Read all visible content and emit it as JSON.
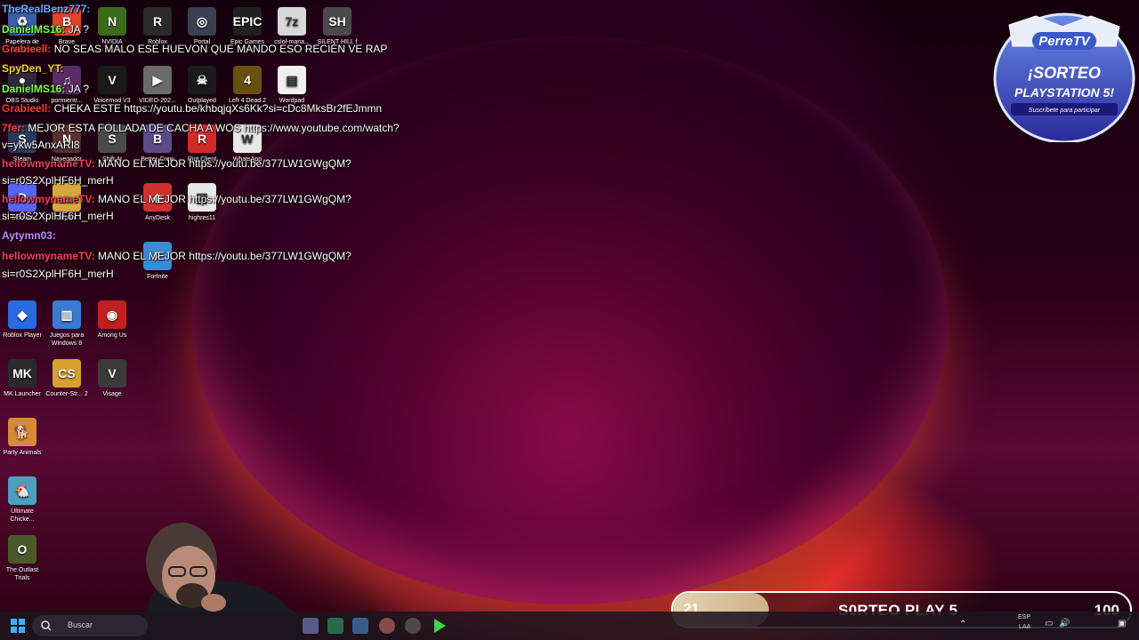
{
  "desktop_icons": [
    {
      "id": "recycle",
      "label": "Papelera de reciclaje",
      "glyph": "♻",
      "color": "#3a5ea8"
    },
    {
      "id": "brave",
      "label": "Brave",
      "glyph": "B",
      "color": "#e0442a"
    },
    {
      "id": "nvidia",
      "label": "NVIDIA",
      "glyph": "N",
      "color": "#3a6b1a"
    },
    {
      "id": "roblox",
      "label": "Roblox",
      "glyph": "R",
      "color": "#2a2a2a"
    },
    {
      "id": "portal",
      "label": "Portal",
      "glyph": "◎",
      "color": "#3a4050"
    },
    {
      "id": "epic",
      "label": "Epic Games",
      "glyph": "EPIC",
      "color": "#202020"
    },
    {
      "id": "7z",
      "label": "cslol-mana...",
      "glyph": "7z",
      "color": "#d8d8d8"
    },
    {
      "id": "silent",
      "label": "SILENT HILL f",
      "glyph": "SH",
      "color": "#4a4a4a"
    },
    {
      "id": "obs",
      "label": "OBS Studio",
      "glyph": "●",
      "color": "#302838"
    },
    {
      "id": "pormientr",
      "label": "pormientr...",
      "glyph": "♫",
      "color": "#5a2a6a"
    },
    {
      "id": "voicemod",
      "label": "Voicemod V3",
      "glyph": "V",
      "color": "#1a1a1a"
    },
    {
      "id": "video",
      "label": "VIDEO-202...",
      "glyph": "▶",
      "color": "#6a6a6a"
    },
    {
      "id": "outplayed",
      "label": "Outplayed",
      "glyph": "☠",
      "color": "#1a1a1a"
    },
    {
      "id": "l4d2",
      "label": "Left 4 Dead 2",
      "glyph": "4",
      "color": "#6a5010"
    },
    {
      "id": "wordpad",
      "label": "Wordpad",
      "glyph": "▤",
      "color": "#f0f0f0"
    },
    {
      "id": "steam",
      "label": "Steam",
      "glyph": "S",
      "color": "#2a3a5a"
    },
    {
      "id": "navegador",
      "label": "Navegador",
      "glyph": "N",
      "color": "#5a3030"
    },
    {
      "id": "shiftat",
      "label": "Shift At",
      "glyph": "S",
      "color": "#4a4a4a"
    },
    {
      "id": "bettercrew",
      "label": "Better-Crew",
      "glyph": "B",
      "color": "#5a4a8a"
    },
    {
      "id": "riot",
      "label": "Riot Client",
      "glyph": "R",
      "color": "#d02a2a"
    },
    {
      "id": "whatsapp",
      "label": "WhatsApp",
      "glyph": "W",
      "color": "#e8e8e8"
    },
    {
      "id": "discord",
      "label": "Discord",
      "glyph": "D",
      "color": "#5865f2"
    },
    {
      "id": "carpeta",
      "label": "carpeta",
      "glyph": "▬",
      "color": "#d8a840"
    },
    {
      "id": "anydesk",
      "label": "AnyDesk",
      "glyph": "◆",
      "color": "#d03030"
    },
    {
      "id": "highres",
      "label": "highres11",
      "glyph": "▤",
      "color": "#e8e8e8"
    },
    {
      "id": "fortnite",
      "label": "Fortnite",
      "glyph": "F",
      "color": "#3a8ad8"
    },
    {
      "id": "robloxplayer",
      "label": "Roblox Player",
      "glyph": "◆",
      "color": "#2a6ae0"
    },
    {
      "id": "juegos",
      "label": "Juegos para Windows 8",
      "glyph": "▥",
      "color": "#3a7ad0"
    },
    {
      "id": "amongus",
      "label": "Among Us",
      "glyph": "◉",
      "color": "#c02020"
    },
    {
      "id": "mk",
      "label": "MK Launcher",
      "glyph": "MK",
      "color": "#2a2a2a"
    },
    {
      "id": "cs2",
      "label": "Counter-Str... 2",
      "glyph": "CS",
      "color": "#d8a030"
    },
    {
      "id": "visage",
      "label": "Visage",
      "glyph": "V",
      "color": "#3a3a3a"
    },
    {
      "id": "party",
      "label": "Party Animals",
      "glyph": "🐕",
      "color": "#d88a3a"
    },
    {
      "id": "chicken",
      "label": "Ultimate Chicke...",
      "glyph": "🐔",
      "color": "#4aa0c0"
    },
    {
      "id": "outlast",
      "label": "The Outlast Trials",
      "glyph": "O",
      "color": "#4a5a2a"
    }
  ],
  "chat": [
    {
      "user": "TheRealBenz777:",
      "user_color": "#6aa8ff",
      "msg": ""
    },
    {
      "user": "DanielMS16:",
      "user_color": "#7cff4a",
      "msg": "JA ?"
    },
    {
      "user": "Grabieell:",
      "user_color": "#ff3a3a",
      "msg": "NO SEAS MALO ESE HUEVON QUE MANDO ESO RECIÉN VE RAP"
    },
    {
      "user": "SpyDen_YT:",
      "user_color": "#ffd02a",
      "msg": ""
    },
    {
      "user": "DanielMS16:",
      "user_color": "#7cff4a",
      "msg": "JA ?"
    },
    {
      "user": "Grabieell:",
      "user_color": "#ff3a3a",
      "msg": "CHEKA ESTE https://youtu.be/khbqjqXs6Kk?si=cDc8MksBr2fEJmmn"
    },
    {
      "user": "7fer:",
      "user_color": "#ff3a3a",
      "msg": "MEJOR ESTA FOLLADA DE CACHA A WOS https://www.youtube.com/watch?"
    },
    {
      "user": "",
      "user_color": "#ffffff",
      "msg": "v=ykw5AnxARI8"
    },
    {
      "user": "hellowmynameTV:",
      "user_color": "#ff3a5a",
      "msg": "MANO EL MEJOR https://youtu.be/377LW1GWgQM?"
    },
    {
      "user": "",
      "user_color": "#ffffff",
      "msg": "si=r0S2XplHF6H_merH"
    },
    {
      "user": "hellowmynameTV:",
      "user_color": "#ff3a5a",
      "msg": "MANO EL MEJOR https://youtu.be/377LW1GWgQM?"
    },
    {
      "user": "",
      "user_color": "#ffffff",
      "msg": "si=r0S2XplHF6H_merH"
    },
    {
      "user": "Aytymn03:",
      "user_color": "#c08aff",
      "msg": ""
    },
    {
      "user": "hellowmynameTV:",
      "user_color": "#ff3a5a",
      "msg": "MANO EL MEJOR https://youtu.be/377LW1GWgQM?"
    },
    {
      "user": "",
      "user_color": "#ffffff",
      "msg": "si=r0S2XplHF6H_merH"
    }
  ],
  "giveaway_badge": {
    "brand": "PerreTV",
    "line1": "¡SORTEO",
    "line2": "PLAYSTATION 5!",
    "sub": "Suscríbete para participar"
  },
  "goal_bar": {
    "current": "21",
    "title": "S0RTEO PLAY 5",
    "goal": "100",
    "progress_fraction": 0.21
  },
  "taskbar": {
    "search_placeholder": "Buscar",
    "tray_lang": "ESP",
    "tray_sub": "LAA"
  }
}
